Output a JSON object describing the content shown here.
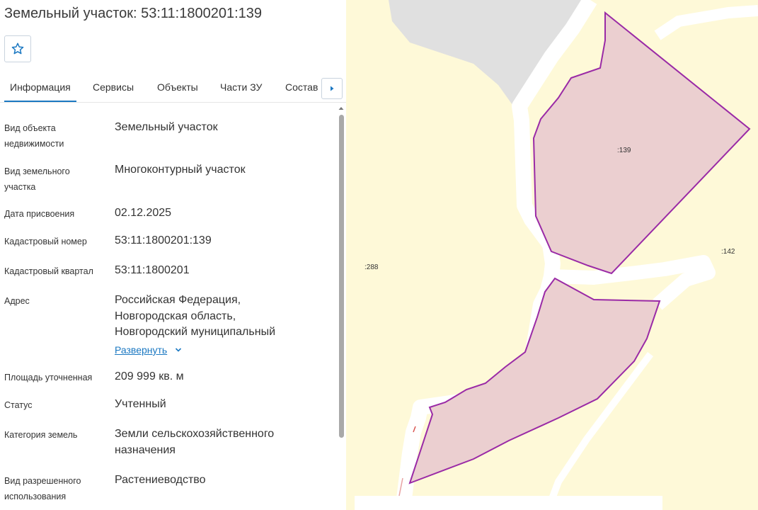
{
  "header": {
    "title": "Земельный участок: 53:11:1800201:139"
  },
  "tabs": [
    {
      "label": "Информация"
    },
    {
      "label": "Сервисы"
    },
    {
      "label": "Объекты"
    },
    {
      "label": "Части ЗУ"
    },
    {
      "label": "Состав"
    }
  ],
  "fields": [
    {
      "label": "Вид объекта недвижимости",
      "value": "Земельный участок"
    },
    {
      "label": "Вид земельного участка",
      "value": "Многоконтурный участок"
    },
    {
      "label": "Дата присвоения",
      "value": "02.12.2025"
    },
    {
      "label": "Кадастровый номер",
      "value": "53:11:1800201:139"
    },
    {
      "label": "Кадастровый квартал",
      "value": "53:11:1800201"
    },
    {
      "label": "Адрес",
      "value": "Российская Федерация, Новгородская область, Новгородский муниципальный"
    },
    {
      "label": "Площадь уточненная",
      "value": "209 999 кв. м"
    },
    {
      "label": "Статус",
      "value": "Учтенный"
    },
    {
      "label": "Категория земель",
      "value": "Земли сельскохозяйственного назначения"
    },
    {
      "label": "Вид разрешенного использования",
      "value": "Растениеводство"
    }
  ],
  "address_expand": "Развернуть",
  "map": {
    "labels": [
      ":139",
      ":288",
      ":142"
    ]
  },
  "colors": {
    "accent": "#1b78c2",
    "parcel_fill": "#ebcfd0",
    "parcel_stroke": "#9a2aa6",
    "land_bg": "#fef9d8",
    "road": "#ffffff",
    "forest_gray": "#e0e0e0"
  },
  "icons": {
    "favorite": "star-icon",
    "tab_next": "caret-right-icon",
    "expand": "chevron-down-icon",
    "scroll_up": "caret-up-icon"
  }
}
